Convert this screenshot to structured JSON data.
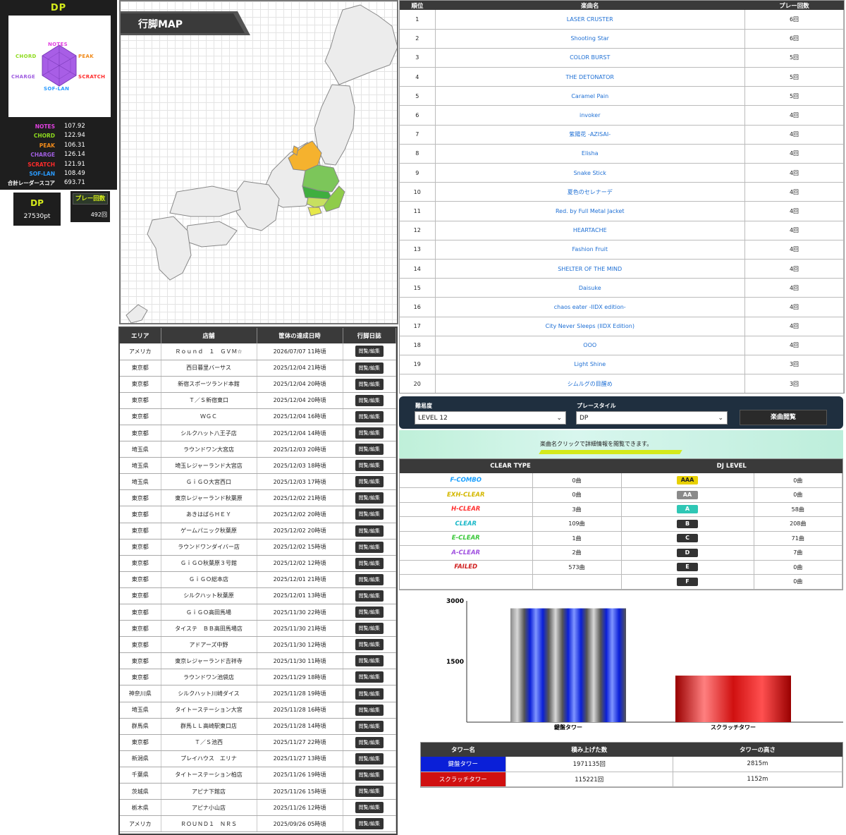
{
  "left_panel": {
    "title": "DP",
    "radar_labels": {
      "notes": "NOTES",
      "chord": "CHORD",
      "peak": "PEAK",
      "charge": "CHARGE",
      "scratch": "SCRATCH",
      "soflan": "SOF-LAN"
    },
    "stats": [
      {
        "label": "NOTES",
        "value": "107.92",
        "color": "#e040e0"
      },
      {
        "label": "CHORD",
        "value": "122.94",
        "color": "#8edb1e"
      },
      {
        "label": "PEAK",
        "value": "106.31",
        "color": "#f08a1a"
      },
      {
        "label": "CHARGE",
        "value": "126.14",
        "color": "#a05ee0"
      },
      {
        "label": "SCRATCH",
        "value": "121.91",
        "color": "#ff2b2b"
      },
      {
        "label": "SOF-LAN",
        "value": "108.49",
        "color": "#2a9bff"
      },
      {
        "label": "合計レーダースコア",
        "value": "693.71",
        "color": "#ffffff"
      }
    ],
    "dp_label": "DP",
    "dp_points": "27530pt",
    "play_count_label": "プレー回数",
    "play_count": "492回"
  },
  "map": {
    "title": "行脚MAP"
  },
  "shop_table": {
    "headers": [
      "エリア",
      "店舗",
      "筐体の達成日時",
      "行脚日誌"
    ],
    "button_label": "閲覧/編集",
    "rows": [
      [
        "アメリカ",
        "Ｒｏｕｎｄ　１　ＧＶＭ☆",
        "2026/07/07 11時頃"
      ],
      [
        "東京都",
        "西日暮里バーサス",
        "2025/12/04 21時頃"
      ],
      [
        "東京都",
        "新宿スポーツランド本館",
        "2025/12/04 20時頃"
      ],
      [
        "東京都",
        "Ｔ／Ｓ新宿東口",
        "2025/12/04 20時頃"
      ],
      [
        "東京都",
        "ＷＧＣ",
        "2025/12/04 16時頃"
      ],
      [
        "東京都",
        "シルクハット八王子店",
        "2025/12/04 14時頃"
      ],
      [
        "埼玉県",
        "ラウンドワン大宮店",
        "2025/12/03 20時頃"
      ],
      [
        "埼玉県",
        "埼玉レジャーランド大宮店",
        "2025/12/03 18時頃"
      ],
      [
        "埼玉県",
        "ＧｉＧＯ大宮西口",
        "2025/12/03 17時頃"
      ],
      [
        "東京都",
        "東京レジャーランド秋葉原",
        "2025/12/02 21時頃"
      ],
      [
        "東京都",
        "あきはばらＨＥＹ",
        "2025/12/02 20時頃"
      ],
      [
        "東京都",
        "ゲームパニック秋葉原",
        "2025/12/02 20時頃"
      ],
      [
        "東京都",
        "ラウンドワンダイバー店",
        "2025/12/02 15時頃"
      ],
      [
        "東京都",
        "ＧｉＧＯ秋葉原３号館",
        "2025/12/02 12時頃"
      ],
      [
        "東京都",
        "ＧｉＧＯ総本店",
        "2025/12/01 21時頃"
      ],
      [
        "東京都",
        "シルクハット秋葉原",
        "2025/12/01 13時頃"
      ],
      [
        "東京都",
        "ＧｉＧＯ高田馬場",
        "2025/11/30 22時頃"
      ],
      [
        "東京都",
        "タイステ　ＢＢ高田馬場店",
        "2025/11/30 21時頃"
      ],
      [
        "東京都",
        "アドアーズ中野",
        "2025/11/30 12時頃"
      ],
      [
        "東京都",
        "東京レジャーランド吉祥寺",
        "2025/11/30 11時頃"
      ],
      [
        "東京都",
        "ラウンドワン池袋店",
        "2025/11/29 18時頃"
      ],
      [
        "神奈川県",
        "シルクハット川崎ダイス",
        "2025/11/28 19時頃"
      ],
      [
        "埼玉県",
        "タイトーステーション大宮",
        "2025/11/28 16時頃"
      ],
      [
        "群馬県",
        "群馬ＬＬ高崎駅東口店",
        "2025/11/28 14時頃"
      ],
      [
        "東京都",
        "Ｔ／Ｓ池西",
        "2025/11/27 22時頃"
      ],
      [
        "新潟県",
        "プレイハウス　エリナ",
        "2025/11/27 13時頃"
      ],
      [
        "千葉県",
        "タイトーステーション柏店",
        "2025/11/26 19時頃"
      ],
      [
        "茨城県",
        "アピナ下館店",
        "2025/11/26 15時頃"
      ],
      [
        "栃木県",
        "アピナ小山店",
        "2025/11/26 12時頃"
      ],
      [
        "アメリカ",
        "ＲＯＵＮＤ１　ＮＲＳ",
        "2025/09/26 05時頃"
      ]
    ]
  },
  "ranking": {
    "headers": [
      "順位",
      "楽曲名",
      "プレー回数"
    ],
    "rows": [
      [
        "1",
        "LASER CRUSTER",
        "6回"
      ],
      [
        "2",
        "Shooting Star",
        "6回"
      ],
      [
        "3",
        "COLOR BURST",
        "5回"
      ],
      [
        "4",
        "THE DETONATOR",
        "5回"
      ],
      [
        "5",
        "Caramel Pain",
        "5回"
      ],
      [
        "6",
        "invoker",
        "4回"
      ],
      [
        "7",
        "紫陽花 -AZISAI-",
        "4回"
      ],
      [
        "8",
        "Elisha",
        "4回"
      ],
      [
        "9",
        "Snake Stick",
        "4回"
      ],
      [
        "10",
        "夏色のセレナーデ",
        "4回"
      ],
      [
        "11",
        "Red. by Full Metal Jacket",
        "4回"
      ],
      [
        "12",
        "HEARTACHE",
        "4回"
      ],
      [
        "13",
        "Fashion Fruit",
        "4回"
      ],
      [
        "14",
        "SHELTER OF THE MIND",
        "4回"
      ],
      [
        "15",
        "Daisuke",
        "4回"
      ],
      [
        "16",
        "chaos eater -IIDX edition-",
        "4回"
      ],
      [
        "17",
        "City Never Sleeps (IIDX Edition)",
        "4回"
      ],
      [
        "18",
        "OOO",
        "4回"
      ],
      [
        "19",
        "Light Shine",
        "3回"
      ],
      [
        "20",
        "シムルグの目醒め",
        "3回"
      ]
    ]
  },
  "filter": {
    "difficulty_label": "難易度",
    "difficulty_value": "LEVEL 12",
    "style_label": "プレースタイル",
    "style_value": "DP",
    "view_button": "楽曲閲覧",
    "hint": "楽曲名クリックで詳細情報を閲覧できます。"
  },
  "clear_table": {
    "headers": [
      "CLEAR TYPE",
      "DJ LEVEL"
    ],
    "rows": [
      {
        "type": "F-COMBO",
        "type_color": "#1aa0ff",
        "count": "0曲",
        "level": "AAA",
        "level_bg": "#e8d000",
        "level_count": "0曲"
      },
      {
        "type": "EXH-CLEAR",
        "type_color": "#d4b800",
        "count": "0曲",
        "level": "AA",
        "level_bg": "#8a8a8a",
        "level_count": "0曲"
      },
      {
        "type": "H-CLEAR",
        "type_color": "#ff3030",
        "count": "3曲",
        "level": "A",
        "level_bg": "#2fc7b5",
        "level_count": "58曲"
      },
      {
        "type": "CLEAR",
        "type_color": "#1ab8c8",
        "count": "109曲",
        "level": "B",
        "level_bg": "#333333",
        "level_count": "208曲"
      },
      {
        "type": "E-CLEAR",
        "type_color": "#3ac83a",
        "count": "1曲",
        "level": "C",
        "level_bg": "#333333",
        "level_count": "71曲"
      },
      {
        "type": "A-CLEAR",
        "type_color": "#a050e0",
        "count": "2曲",
        "level": "D",
        "level_bg": "#333333",
        "level_count": "7曲"
      },
      {
        "type": "FAILED",
        "type_color": "#d02020",
        "count": "573曲",
        "level": "E",
        "level_bg": "#333333",
        "level_count": "0曲"
      },
      {
        "type": "",
        "type_color": "#000000",
        "count": "",
        "level": "F",
        "level_bg": "#333333",
        "level_count": "0曲"
      }
    ]
  },
  "chart_data": {
    "type": "bar",
    "categories": [
      "鍵盤タワー",
      "スクラッチタワー"
    ],
    "values": [
      2815,
      1152
    ],
    "yticks": [
      "3000",
      "1500"
    ],
    "ylim": [
      0,
      3000
    ]
  },
  "tower_table": {
    "headers": [
      "タワー名",
      "積み上げた数",
      "タワーの高さ"
    ],
    "rows": [
      {
        "name": "鍵盤タワー",
        "color": "#0a1fd8",
        "count": "1971135回",
        "height": "2815m"
      },
      {
        "name": "スクラッチタワー",
        "color": "#d01010",
        "count": "115221回",
        "height": "1152m"
      }
    ]
  }
}
